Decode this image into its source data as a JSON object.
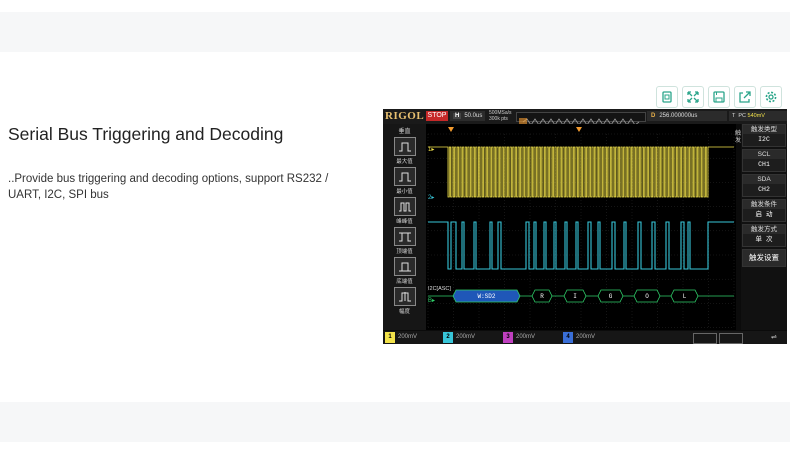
{
  "section": {
    "title": "Serial Bus Triggering and Decoding",
    "description": "..Provide bus triggering and decoding options, support RS232 / UART, I2C, SPI bus"
  },
  "toolbar": {
    "icons": [
      "copy-icon",
      "fullscreen-icon",
      "save-icon",
      "share-icon",
      "settings-icon"
    ],
    "accent": "#2aa58a"
  },
  "scope": {
    "brand": "RIGOL",
    "run_state": "STOP",
    "timebase_label": "H",
    "timebase": "50.0us",
    "sample_rate": "500MSa/s",
    "memory_depth": "300k pts",
    "delay_label": "D",
    "delay": "256.000000us",
    "trigger_label": "T",
    "trigger_source": "PC",
    "trigger_level": "540mV",
    "left_menu": {
      "header": "垂直",
      "items": [
        "最大值",
        "最小值",
        "峰峰值",
        "顶端值",
        "底端值",
        "幅度"
      ]
    },
    "right_label": "触发",
    "right_menu": [
      {
        "title": "触发类型",
        "value": "I2C"
      },
      {
        "title": "SCL",
        "value": "CH1"
      },
      {
        "title": "SDA",
        "value": "CH2"
      },
      {
        "title": "触发条件",
        "value": "启 动"
      },
      {
        "title": "触发方式",
        "value": "单 次"
      },
      {
        "title": "",
        "value": "触发设置"
      }
    ],
    "decode_label": "I2C[ASC]",
    "decode_frames": [
      "W:SD2",
      "R",
      "I",
      "G",
      "O",
      "L"
    ],
    "channels": [
      {
        "num": "1",
        "scale": "200mV",
        "color": "#f2e24a"
      },
      {
        "num": "2",
        "scale": "200mV",
        "color": "#38c6d9"
      },
      {
        "num": "3",
        "scale": "200mV",
        "color": "#c040c0"
      },
      {
        "num": "4",
        "scale": "200mV",
        "color": "#3a6fd8"
      }
    ],
    "colors": {
      "ch1": "#f2e24a",
      "ch2": "#38c6d9",
      "decode": "#2fd06a",
      "trigger": "#f29a2e"
    }
  }
}
